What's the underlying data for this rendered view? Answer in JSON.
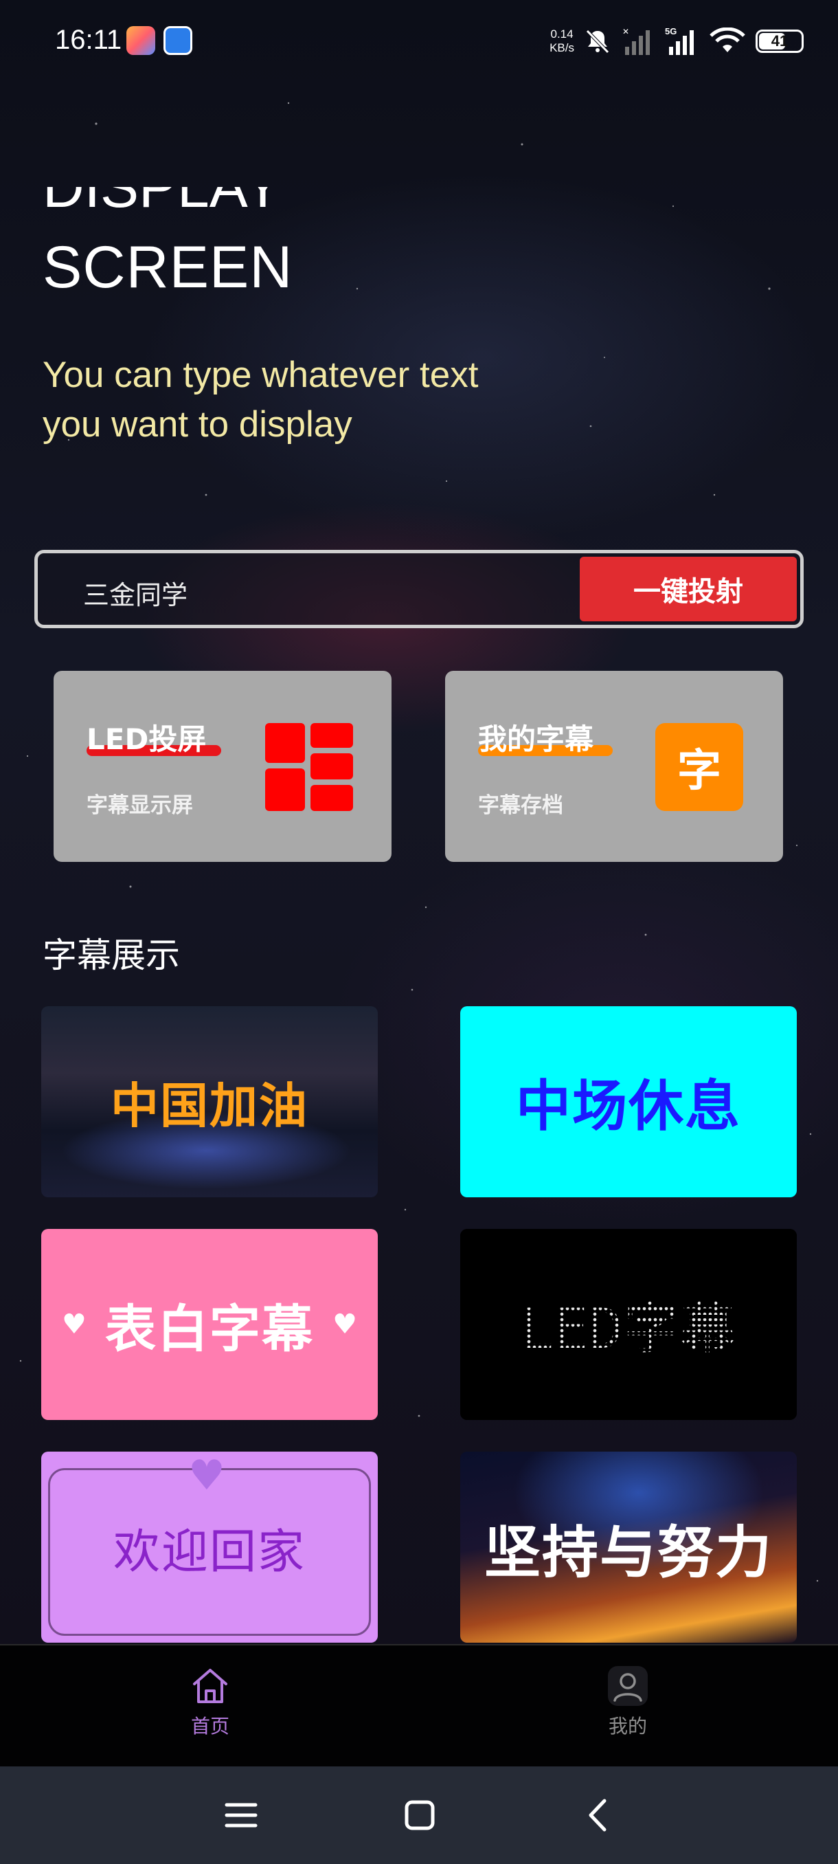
{
  "status_bar": {
    "time": "16:11",
    "net_speed_value": "0.14",
    "net_speed_unit": "KB/s",
    "network_type": "5G",
    "battery": "41"
  },
  "hero": {
    "title_cut": "DISPLAY",
    "title": "SCREEN",
    "subtitle": "You can type whatever text you want to display"
  },
  "input": {
    "value": "三金同学",
    "cast_button": "一键投射"
  },
  "features": [
    {
      "title": "LED投屏",
      "subtitle": "字幕显示屏",
      "icon": "grid-icon",
      "accent": "#e8151b"
    },
    {
      "title": "我的字幕",
      "subtitle": "字幕存档",
      "icon": "zi-icon",
      "icon_text": "字",
      "accent": "#ff8a00"
    }
  ],
  "section": {
    "title": "字幕展示"
  },
  "showcase": [
    {
      "text": "中国加油"
    },
    {
      "text": "中场休息"
    },
    {
      "text": "表白字幕"
    },
    {
      "text": "LED字幕"
    },
    {
      "text": "欢迎回家"
    },
    {
      "text": "坚持与努力"
    }
  ],
  "bottom_nav": [
    {
      "label": "首页",
      "icon": "home-icon",
      "active": true,
      "color": "#b47bde"
    },
    {
      "label": "我的",
      "icon": "user-icon",
      "active": false,
      "color": "#8f8f8f"
    }
  ],
  "system_nav": [
    "menu-icon",
    "home-square-icon",
    "back-icon"
  ]
}
